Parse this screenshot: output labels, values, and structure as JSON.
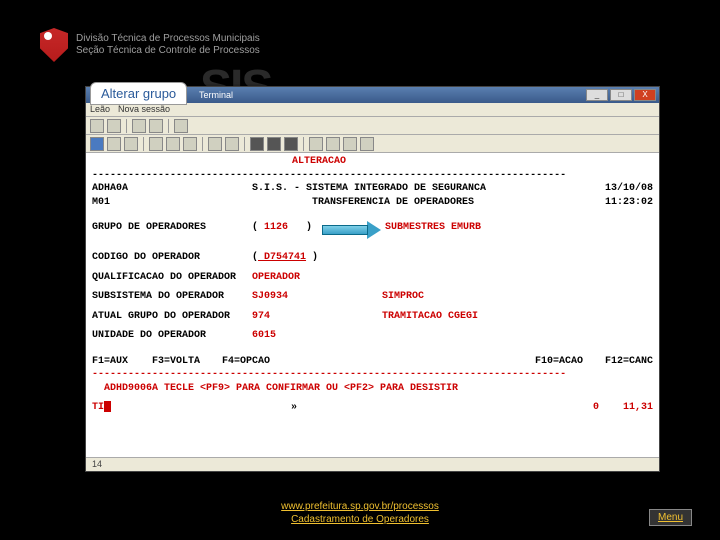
{
  "header": {
    "line1": "Divisão Técnica de Processos Municipais",
    "line2": "Seção Técnica de Controle de Processos"
  },
  "sis_bg": "SIS",
  "tab_label": "Alterar grupo",
  "window": {
    "title": "Terminal",
    "menu": [
      "Leão",
      "Nova sessão"
    ],
    "min": "_",
    "max": "□",
    "close": "X"
  },
  "term": {
    "alteracao": "ALTERACAO",
    "dashes": "-------------------------------------------------------------------------------",
    "adha0a": "ADHA0A",
    "sys_title": "S.I.S. - SISTEMA INTEGRADO DE SEGURANCA",
    "date": "13/10/08",
    "m01": "M01",
    "sys_sub": "TRANSFERENCIA DE OPERADORES",
    "time": "11:23:02",
    "grupo_label": "GRUPO DE OPERADORES",
    "grupo_open": "(",
    "grupo_val": " 1126",
    "grupo_close": "   )",
    "grupo_desc": "SUBMESTRES EMURB",
    "codigo_label": "CODIGO DO OPERADOR",
    "codigo_open": "(",
    "codigo_val": " D754741",
    "codigo_close": " )",
    "qualif_label": "QUALIFICACAO DO OPERADOR",
    "qualif_val": "OPERADOR",
    "subsis_label": "SUBSISTEMA DO OPERADOR",
    "subsis_val": "SJ0934",
    "subsis_desc": "SIMPROC",
    "atual_label": "ATUAL GRUPO DO OPERADOR",
    "atual_val": "974",
    "atual_desc": "TRAMITACAO CGEGI",
    "unidade_label": "UNIDADE DO OPERADOR",
    "unidade_val": "6015",
    "f1": "F1=AUX",
    "f3": "F3=VOLTA",
    "f4": "F4=OPCAO",
    "f10": "F10=ACAO",
    "f12": "F12=CANC",
    "msg": "  ADHD9006A TECLE <PF9> PARA CONFIRMAR OU <PF2> PARA DESISTIR",
    "ti": "TI",
    "arrows": "»",
    "zero": "0",
    "pos": "11,31",
    "status": "14"
  },
  "footer": {
    "link1": "www.prefeitura.sp.gov.br/processos",
    "link2": "Cadastramento de Operadores",
    "menu": "Menu"
  }
}
